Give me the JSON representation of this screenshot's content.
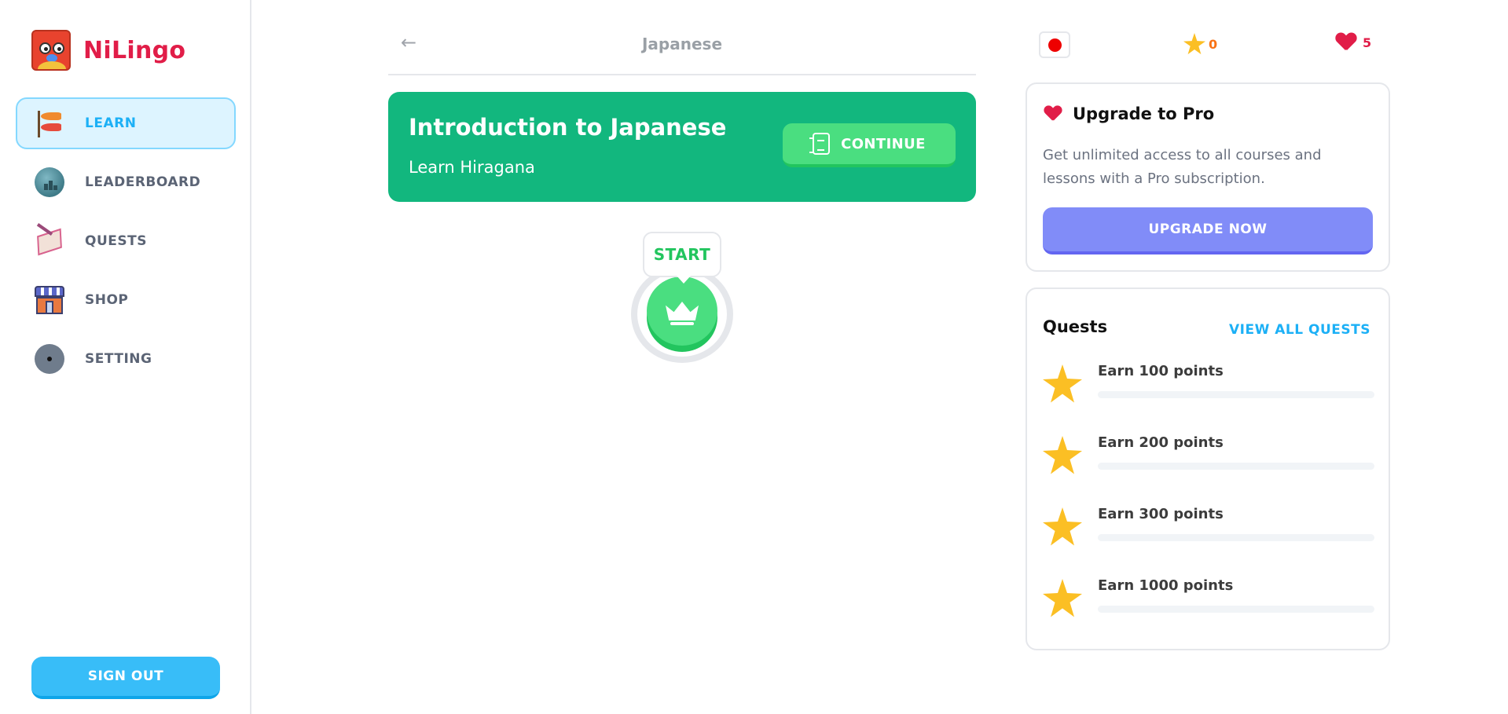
{
  "app": {
    "name": "NiLingo"
  },
  "sidebar": {
    "items": [
      {
        "label": "LEARN",
        "icon": "koinobori-icon",
        "active": true
      },
      {
        "label": "LEADERBOARD",
        "icon": "globe-icon",
        "active": false
      },
      {
        "label": "QUESTS",
        "icon": "quest-map-icon",
        "active": false
      },
      {
        "label": "SHOP",
        "icon": "shop-icon",
        "active": false
      },
      {
        "label": "SETTING",
        "icon": "gear-icon",
        "active": false
      }
    ],
    "sign_out_label": "SIGN OUT"
  },
  "header": {
    "course_title": "Japanese",
    "back_icon": "arrow-left-icon"
  },
  "unit": {
    "title": "Introduction to Japanese",
    "subtitle": "Learn Hiragana",
    "continue_label": "CONTINUE"
  },
  "lesson": {
    "start_label": "START",
    "icon": "crown-icon"
  },
  "stats": {
    "flag": "japan-flag-icon",
    "points": "0",
    "hearts": "5"
  },
  "pro": {
    "title": "Upgrade to Pro",
    "description": "Get unlimited access to all courses and lessons with a Pro subscription.",
    "button_label": "UPGRADE NOW"
  },
  "quests": {
    "title": "Quests",
    "view_all_label": "VIEW ALL QUESTS",
    "items": [
      {
        "label": "Earn 100 points",
        "progress": 0
      },
      {
        "label": "Earn 200 points",
        "progress": 0
      },
      {
        "label": "Earn 300 points",
        "progress": 0
      },
      {
        "label": "Earn 1000 points",
        "progress": 0
      }
    ]
  },
  "colors": {
    "brand": "#e11d48",
    "accent_blue": "#1cb0f6",
    "unit_green": "#12b77e",
    "button_green": "#4ade80",
    "pro_button": "#818cf8"
  }
}
